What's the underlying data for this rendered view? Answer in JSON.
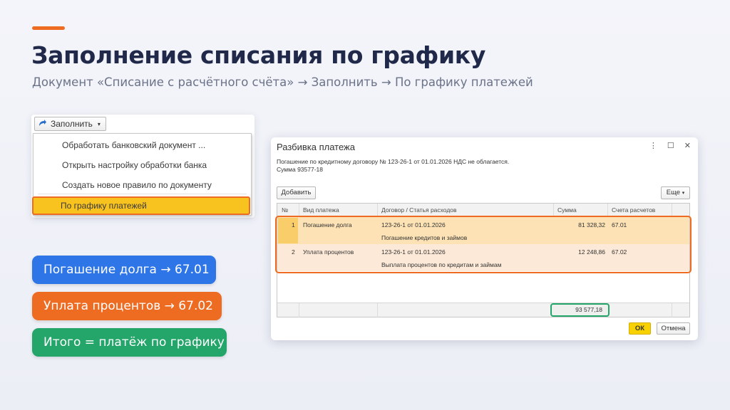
{
  "slide": {
    "title": "Заполнение списания по графику",
    "subtitle": "Документ «Списание с расчётного счёта» → Заполнить → По графику платежей",
    "accent_color": "#ee6b22"
  },
  "fill_menu": {
    "button_label": "Заполнить",
    "button_icon": "fill-arrow-icon",
    "items": [
      "Обработать банковский документ ...",
      "Открыть настройку обработки банка",
      "Создать новое правило по документу"
    ],
    "highlighted_item": "По графику платежей"
  },
  "pills": {
    "debt": "Погашение долга → 67.01",
    "interest": "Уплата процентов → 67.02",
    "total": "Итого = платёж по графику",
    "colors": {
      "debt": "#2e75e8",
      "interest": "#ee6b22",
      "total": "#24a56a"
    }
  },
  "dialog": {
    "title": "Разбивка платежа",
    "controls": [
      "⋮",
      "☐",
      "✕"
    ],
    "description_line1": "Погашение по кредитному договору № 123-26-1 от 01.01.2026 НДС не облагается.",
    "description_line2": "Сумма 93577-18",
    "add_button": "Добавить",
    "more_button": "Еще",
    "columns": [
      "№",
      "Вид платежа",
      "Договор / Статья расходов",
      "Сумма",
      "Счета расчетов"
    ],
    "rows": [
      {
        "num": "1",
        "type": "Погашение долга",
        "contract": "123-26-1 от 01.01.2026",
        "article": "Погашение кредитов и займов",
        "amount": "81 328,32",
        "account": "67.01"
      },
      {
        "num": "2",
        "type": "Уплата процентов",
        "contract": "123-26-1 от 01.01.2026",
        "article": "Выплата процентов по кредитам и займам",
        "amount": "12 248,86",
        "account": "67.02"
      }
    ],
    "total": "93 577,18",
    "ok_button": "ОК",
    "cancel_button": "Отмена"
  }
}
